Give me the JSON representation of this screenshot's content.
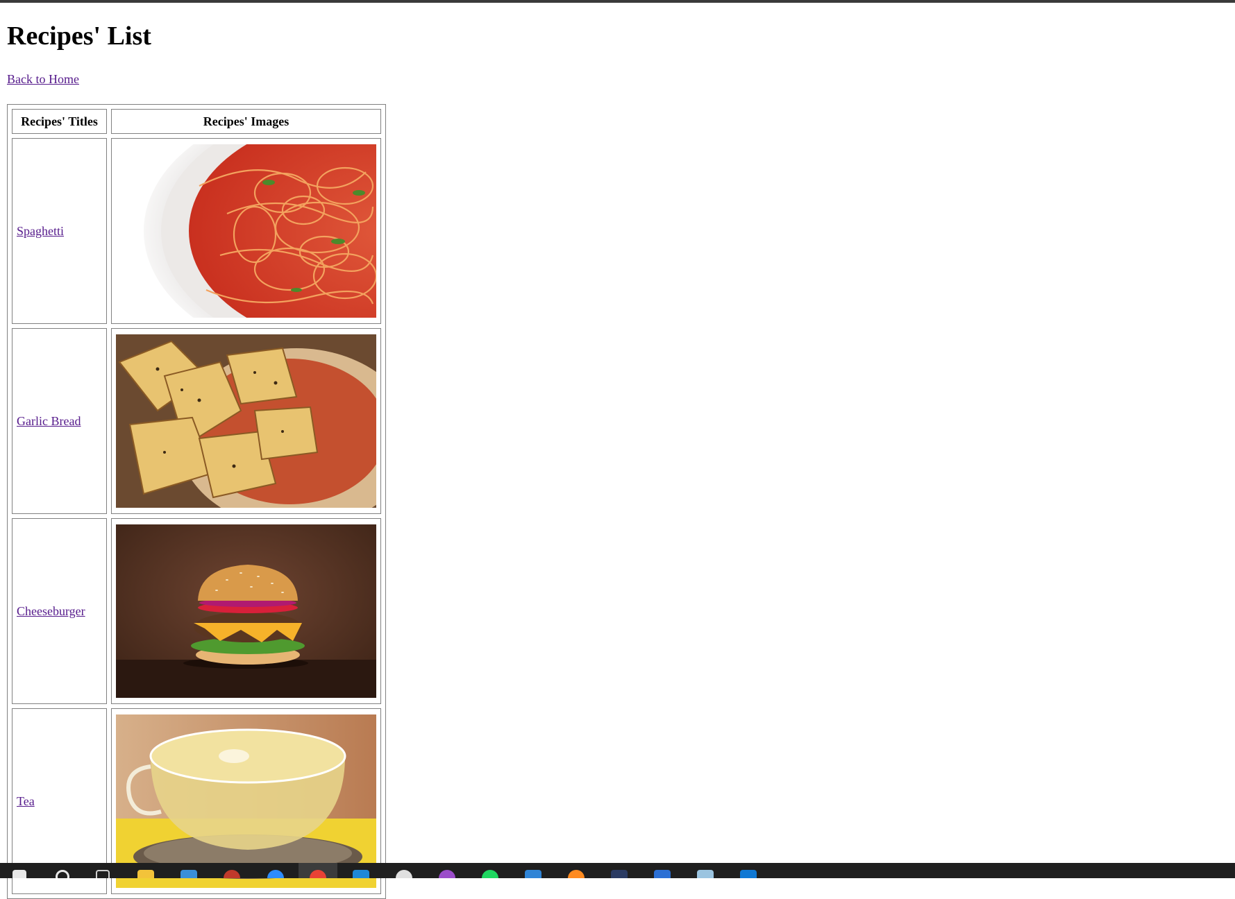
{
  "page": {
    "title": "Recipes' List",
    "back_link": "Back to Home"
  },
  "table": {
    "headers": {
      "title": "Recipes' Titles",
      "image": "Recipes' Images"
    },
    "rows": [
      {
        "title": "Spaghetti",
        "image_icon": "spaghetti-image"
      },
      {
        "title": "Garlic Bread",
        "image_icon": "garlic-bread-image"
      },
      {
        "title": "Cheeseburger",
        "image_icon": "cheeseburger-image"
      },
      {
        "title": "Tea",
        "image_icon": "tea-image"
      }
    ]
  },
  "taskbar": {
    "icons": [
      "windows-start-icon",
      "search-icon",
      "task-view-icon",
      "file-explorer-icon",
      "store-icon",
      "app-icon",
      "zoom-icon",
      "chrome-icon",
      "vscode-icon",
      "slack-icon",
      "podcast-icon",
      "spotify-icon",
      "calendar-icon",
      "firefox-icon",
      "terminal-icon",
      "word-icon",
      "notepad-icon",
      "outlook-icon"
    ]
  },
  "colors": {
    "link_visited": "#551a8b",
    "border": "#808080",
    "taskbar": "#1f1f1f"
  }
}
